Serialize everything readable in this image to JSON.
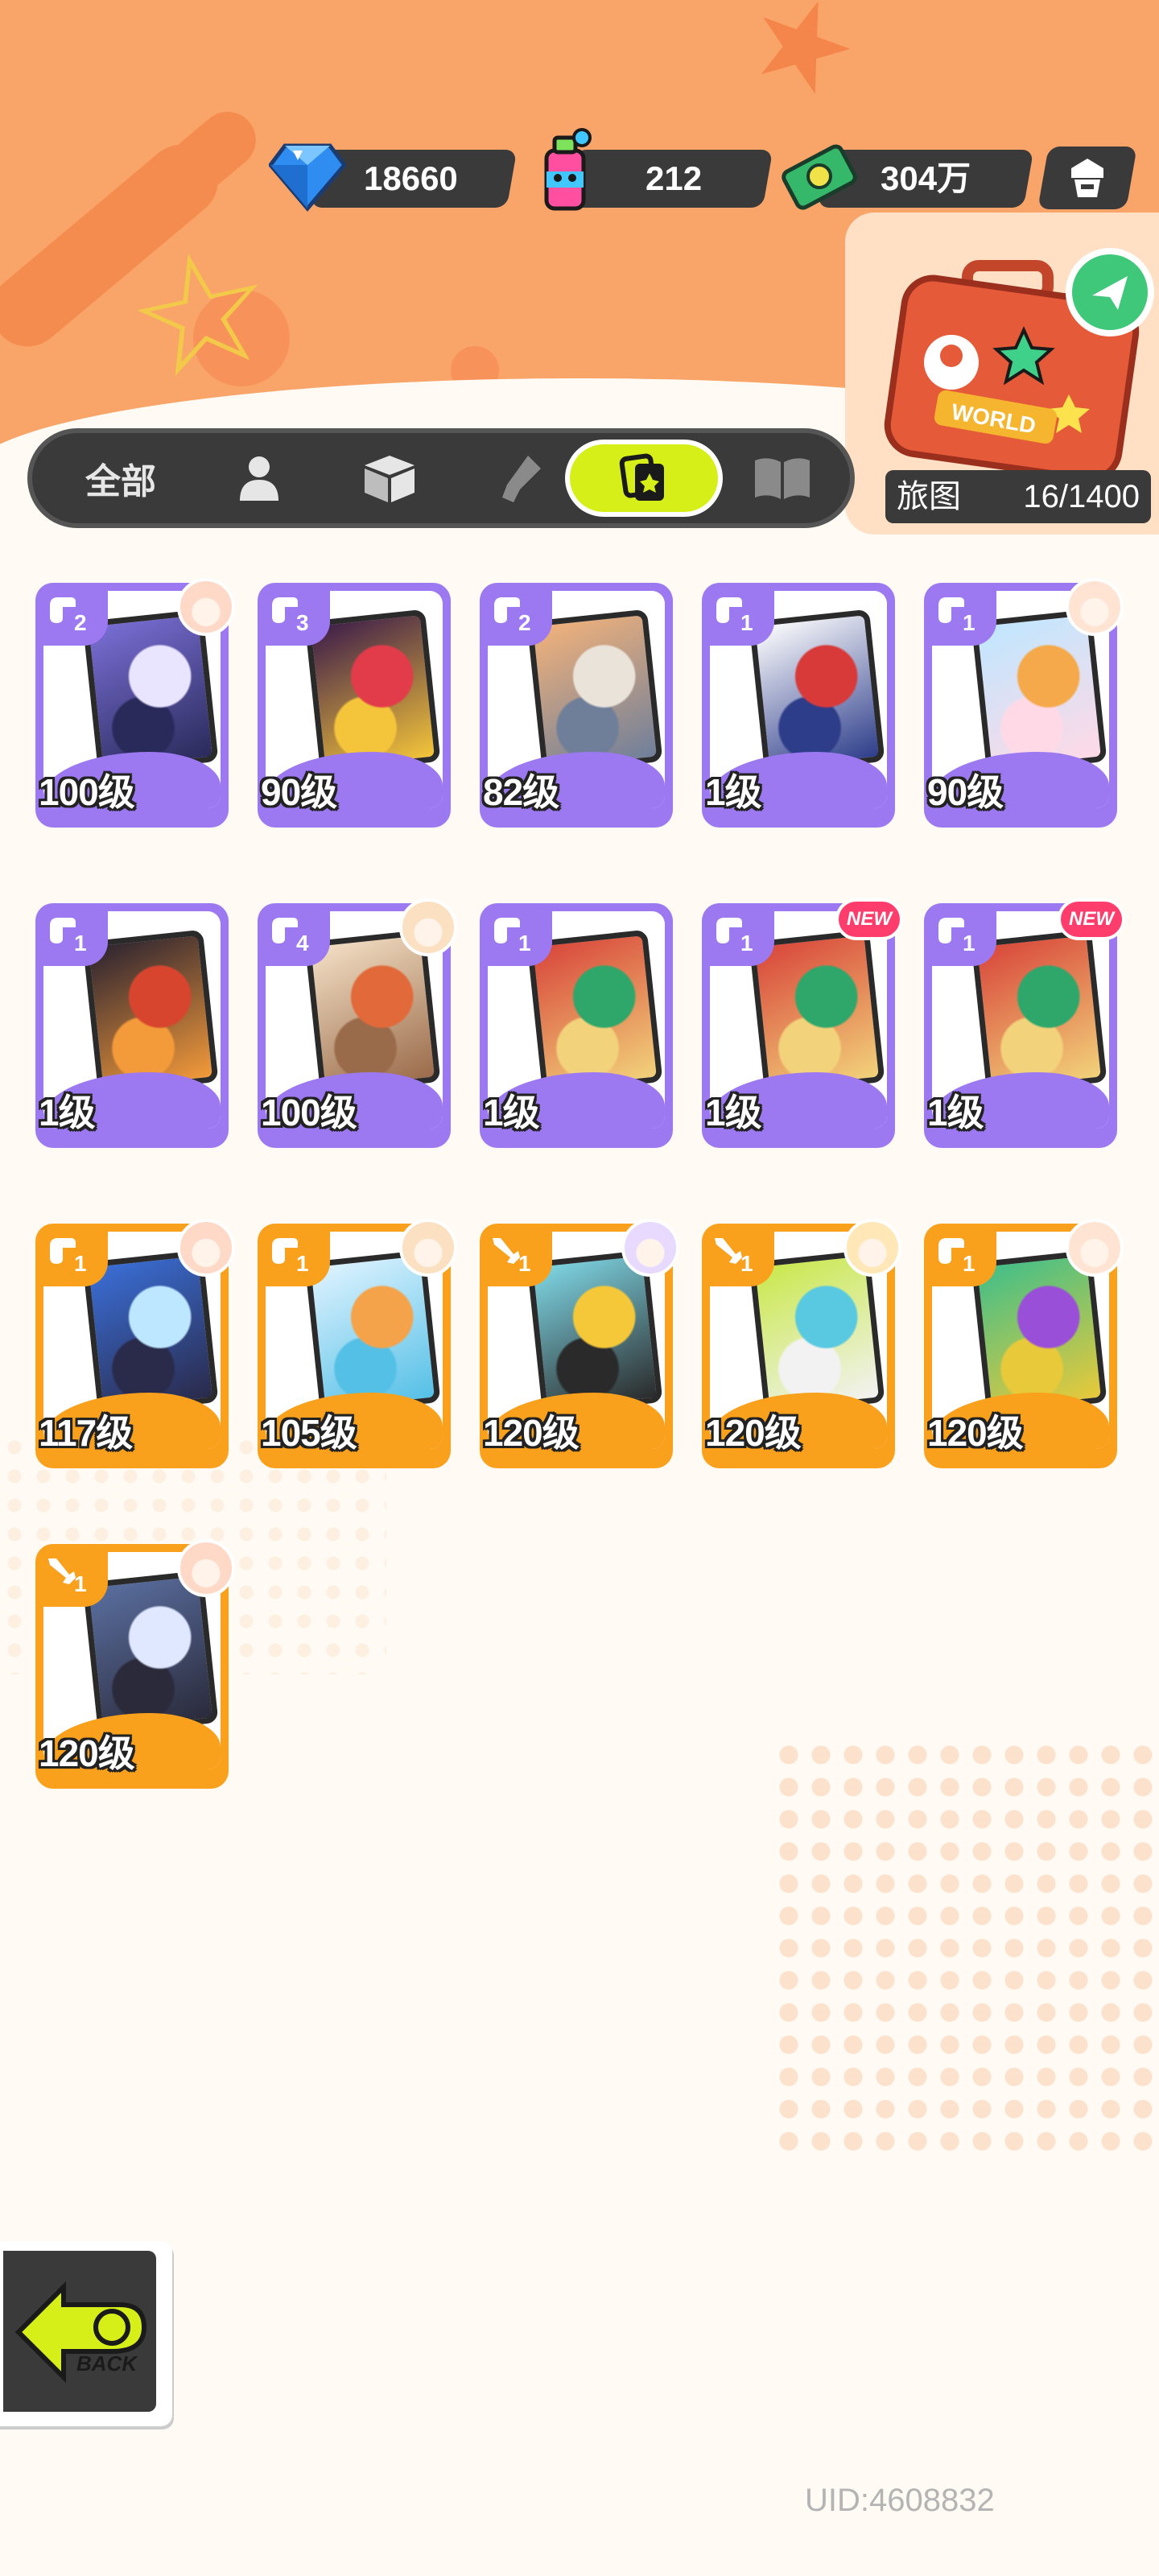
{
  "currency": {
    "diamonds": "18660",
    "paint": "212",
    "cash": "304万"
  },
  "travel_map": {
    "label": "旅图",
    "progress": "16/1400",
    "suitcase_text": "WORLD"
  },
  "tabs": {
    "all_label": "全部",
    "active_index": 4
  },
  "cards": [
    {
      "level": "100级",
      "count": "2",
      "rarity": "purple",
      "type_icon": "hand-icon",
      "corner": "avatar",
      "art": "ufo"
    },
    {
      "level": "90级",
      "count": "3",
      "rarity": "purple",
      "type_icon": "hand-icon",
      "corner": "none",
      "art": "dark-stage"
    },
    {
      "level": "82级",
      "count": "2",
      "rarity": "purple",
      "type_icon": "hand-icon",
      "corner": "none",
      "art": "robot"
    },
    {
      "level": "1级",
      "count": "1",
      "rarity": "purple",
      "type_icon": "hand-icon",
      "corner": "none",
      "art": "football"
    },
    {
      "level": "90级",
      "count": "1",
      "rarity": "purple",
      "type_icon": "hand-icon",
      "corner": "avatar",
      "art": "dog"
    },
    {
      "level": "1级",
      "count": "1",
      "rarity": "purple",
      "type_icon": "hand-icon",
      "corner": "none",
      "art": "fireworks"
    },
    {
      "level": "100级",
      "count": "4",
      "rarity": "purple",
      "type_icon": "hand-icon",
      "corner": "avatar",
      "art": "bear"
    },
    {
      "level": "1级",
      "count": "1",
      "rarity": "purple",
      "type_icon": "hand-icon",
      "corner": "none",
      "art": "dragon"
    },
    {
      "level": "1级",
      "count": "1",
      "rarity": "purple",
      "type_icon": "hand-icon",
      "corner": "new",
      "art": "dragon"
    },
    {
      "level": "1级",
      "count": "1",
      "rarity": "purple",
      "type_icon": "hand-icon",
      "corner": "new",
      "art": "dragon"
    },
    {
      "level": "117级",
      "count": "1",
      "rarity": "orange",
      "type_icon": "hand-icon",
      "corner": "avatar",
      "art": "girl-blue"
    },
    {
      "level": "105级",
      "count": "1",
      "rarity": "orange",
      "type_icon": "hand-icon",
      "corner": "avatar",
      "art": "girl-orange"
    },
    {
      "level": "120级",
      "count": "1",
      "rarity": "orange",
      "type_icon": "sword-icon",
      "corner": "avatar",
      "art": "girl-gold"
    },
    {
      "level": "120级",
      "count": "1",
      "rarity": "orange",
      "type_icon": "sword-icon",
      "corner": "avatar",
      "art": "girl-green"
    },
    {
      "level": "120级",
      "count": "1",
      "rarity": "orange",
      "type_icon": "hand-icon",
      "corner": "avatar",
      "art": "girl-purple"
    },
    {
      "level": "120级",
      "count": "1",
      "rarity": "orange",
      "type_icon": "sword-icon",
      "corner": "avatar",
      "art": "girl-silver"
    }
  ],
  "new_label": "NEW",
  "back_label": "BACK",
  "uid": "UID:4608832",
  "colors": {
    "header": "#f9a468",
    "purple_rarity": "#9c79f1",
    "orange_rarity": "#f9a11d",
    "active_tab": "#d6ef19",
    "dark": "#3a3a3a"
  }
}
